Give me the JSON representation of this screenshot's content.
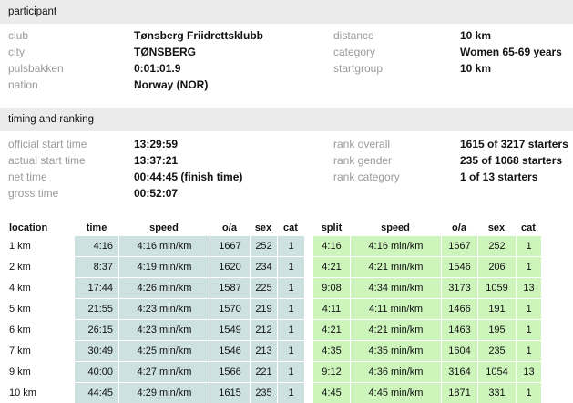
{
  "participant": {
    "title": "participant",
    "fields": [
      {
        "label": "club",
        "value": "Tønsberg Friidrettsklubb"
      },
      {
        "label": "city",
        "value": "TØNSBERG"
      },
      {
        "label": "pulsbakken",
        "value": "0:01:01.9"
      },
      {
        "label": "nation",
        "value": "Norway (NOR)"
      }
    ],
    "fields_right": [
      {
        "label": "distance",
        "value": "10 km"
      },
      {
        "label": "category",
        "value": "Women 65-69 years"
      },
      {
        "label": "startgroup",
        "value": "10 km"
      }
    ]
  },
  "timing": {
    "title": "timing and ranking",
    "fields": [
      {
        "label": "official start time",
        "value": "13:29:59"
      },
      {
        "label": "actual start time",
        "value": "13:37:21"
      },
      {
        "label": "net time",
        "value": "00:44:45 (finish time)"
      },
      {
        "label": "gross time",
        "value": "00:52:07"
      }
    ],
    "fields_right": [
      {
        "label": "rank overall",
        "value": "1615 of 3217 starters"
      },
      {
        "label": "rank gender",
        "value": "235 of 1068 starters"
      },
      {
        "label": "rank category",
        "value": "1 of 13 starters"
      }
    ]
  },
  "splits": {
    "headers": [
      "location",
      "time",
      "speed",
      "o/a",
      "sex",
      "cat",
      "split",
      "speed",
      "o/a",
      "sex",
      "cat"
    ],
    "rows": [
      [
        "1 km",
        "4:16",
        "4:16 min/km",
        "1667",
        "252",
        "1",
        "4:16",
        "4:16 min/km",
        "1667",
        "252",
        "1"
      ],
      [
        "2 km",
        "8:37",
        "4:19 min/km",
        "1620",
        "234",
        "1",
        "4:21",
        "4:21 min/km",
        "1546",
        "206",
        "1"
      ],
      [
        "4 km",
        "17:44",
        "4:26 min/km",
        "1587",
        "225",
        "1",
        "9:08",
        "4:34 min/km",
        "3173",
        "1059",
        "13"
      ],
      [
        "5 km",
        "21:55",
        "4:23 min/km",
        "1570",
        "219",
        "1",
        "4:11",
        "4:11 min/km",
        "1466",
        "191",
        "1"
      ],
      [
        "6 km",
        "26:15",
        "4:23 min/km",
        "1549",
        "212",
        "1",
        "4:21",
        "4:21 min/km",
        "1463",
        "195",
        "1"
      ],
      [
        "7 km",
        "30:49",
        "4:25 min/km",
        "1546",
        "213",
        "1",
        "4:35",
        "4:35 min/km",
        "1604",
        "235",
        "1"
      ],
      [
        "9 km",
        "40:00",
        "4:27 min/km",
        "1566",
        "221",
        "1",
        "9:12",
        "4:36 min/km",
        "3164",
        "1054",
        "13"
      ],
      [
        "10 km",
        "44:45",
        "4:29 min/km",
        "1615",
        "235",
        "1",
        "4:45",
        "4:45 min/km",
        "1871",
        "331",
        "1"
      ]
    ]
  }
}
